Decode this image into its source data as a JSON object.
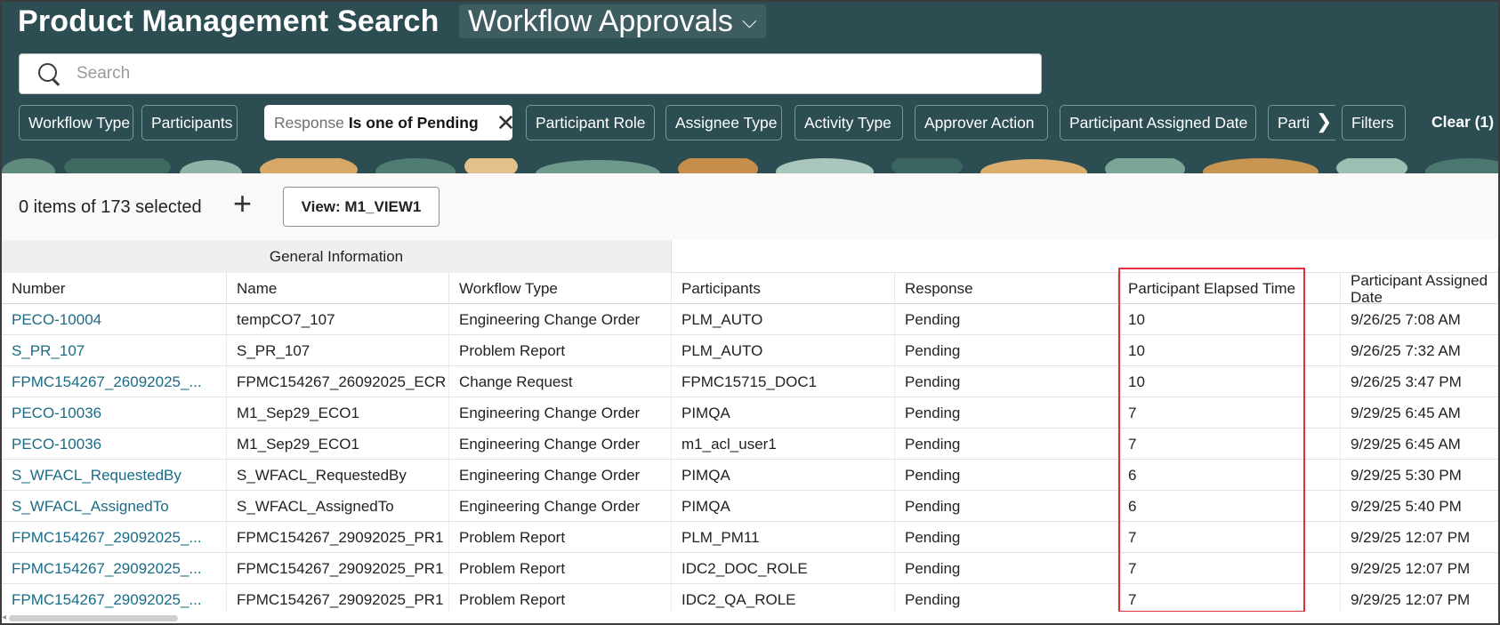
{
  "header": {
    "title": "Product Management Search",
    "scope_label": "Workflow Approvals",
    "search_placeholder": "Search"
  },
  "filters": {
    "chips": [
      "Workflow Type",
      "Participants",
      "Participant Role",
      "Assignee Type",
      "Activity Type",
      "Approver Action",
      "Participant Assigned Date",
      "Parti"
    ],
    "active_chip_label": "Response",
    "active_chip_value": "Is one of Pending",
    "filters_button": "Filters",
    "clear_label": "Clear (1)"
  },
  "toolbar": {
    "selection_text": "0 items of 173 selected",
    "add_symbol": "+",
    "view_button": "View: M1_VIEW1"
  },
  "table": {
    "group_header": "General Information",
    "columns": [
      "Number",
      "Name",
      "Workflow Type",
      "Participants",
      "Response",
      "Participant Elapsed Time",
      "Participant Assigned Date"
    ],
    "rows": [
      [
        "PECO-10004",
        "tempCO7_107",
        "Engineering Change Order",
        "PLM_AUTO",
        "Pending",
        "10",
        "9/26/25 7:08 AM"
      ],
      [
        "S_PR_107",
        "S_PR_107",
        "Problem Report",
        "PLM_AUTO",
        "Pending",
        "10",
        "9/26/25 7:32 AM"
      ],
      [
        "FPMC154267_26092025_...",
        "FPMC154267_26092025_ECR",
        "Change Request",
        "FPMC15715_DOC1",
        "Pending",
        "10",
        "9/26/25 3:47 PM"
      ],
      [
        "PECO-10036",
        "M1_Sep29_ECO1",
        "Engineering Change Order",
        "PIMQA",
        "Pending",
        "7",
        "9/29/25 6:45 AM"
      ],
      [
        "PECO-10036",
        "M1_Sep29_ECO1",
        "Engineering Change Order",
        "m1_acl_user1",
        "Pending",
        "7",
        "9/29/25 6:45 AM"
      ],
      [
        "S_WFACL_RequestedBy",
        "S_WFACL_RequestedBy",
        "Engineering Change Order",
        "PIMQA",
        "Pending",
        "6",
        "9/29/25 5:30 PM"
      ],
      [
        "S_WFACL_AssignedTo",
        "S_WFACL_AssignedTo",
        "Engineering Change Order",
        "PIMQA",
        "Pending",
        "6",
        "9/29/25 5:40 PM"
      ],
      [
        "FPMC154267_29092025_...",
        "FPMC154267_29092025_PR1",
        "Problem Report",
        "PLM_PM11",
        "Pending",
        "7",
        "9/29/25 12:07 PM"
      ],
      [
        "FPMC154267_29092025_...",
        "FPMC154267_29092025_PR1",
        "Problem Report",
        "IDC2_DOC_ROLE",
        "Pending",
        "7",
        "9/29/25 12:07 PM"
      ],
      [
        "FPMC154267_29092025_...",
        "FPMC154267_29092025_PR1",
        "Problem Report",
        "IDC2_QA_ROLE",
        "Pending",
        "7",
        "9/29/25 12:07 PM"
      ]
    ]
  },
  "icons": {
    "search": "search-icon",
    "scope_chevron": "chevron-down-icon",
    "chip_remove": "close-icon",
    "chips_scroll": "chevron-right-icon"
  },
  "colors": {
    "header_bg": "#2c4d52",
    "link": "#1a6b86",
    "highlight": "#e0313a"
  }
}
